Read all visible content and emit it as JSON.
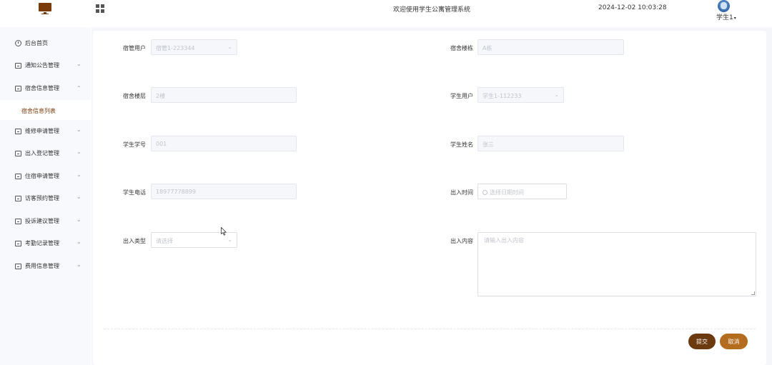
{
  "header": {
    "welcome": "欢迎使用学生公寓管理系统",
    "datetime": "2024-12-02 10:03:28",
    "username": "学生1",
    "caret": "▾"
  },
  "sidebar": {
    "items": [
      {
        "label": "后台首页",
        "icon": "clock-icon",
        "chevron": ""
      },
      {
        "label": "通知公告管理",
        "icon": "doc-icon",
        "chevron": "⌄"
      },
      {
        "label": "宿舍信息管理",
        "icon": "doc-icon",
        "chevron": "⌃"
      },
      {
        "label": "维修申请管理",
        "icon": "doc-icon",
        "chevron": "⌄"
      },
      {
        "label": "出入登记管理",
        "icon": "doc-icon",
        "chevron": "⌄"
      },
      {
        "label": "住宿申请管理",
        "icon": "doc-icon",
        "chevron": "⌄"
      },
      {
        "label": "访客预约管理",
        "icon": "doc-icon",
        "chevron": "⌄"
      },
      {
        "label": "投诉建议管理",
        "icon": "doc-icon",
        "chevron": "⌄"
      },
      {
        "label": "考勤记录管理",
        "icon": "doc-icon",
        "chevron": "⌄"
      },
      {
        "label": "费用信息管理",
        "icon": "doc-icon",
        "chevron": "⌄"
      }
    ],
    "active_sub": "宿舍信息列表"
  },
  "form": {
    "dorm_user": {
      "label": "宿管用户",
      "value": "宿管1-223344"
    },
    "dorm_building": {
      "label": "宿舍楼栋",
      "value": "A栋"
    },
    "dorm_floor": {
      "label": "宿舍楼层",
      "value": "2楼"
    },
    "student_user": {
      "label": "学生用户",
      "value": "学生1-112233"
    },
    "student_no": {
      "label": "学生学号",
      "value": "001"
    },
    "student_name": {
      "label": "学生姓名",
      "value": "张三"
    },
    "student_phone": {
      "label": "学生电话",
      "value": "18977778899"
    },
    "access_time": {
      "label": "出入时间",
      "placeholder": "选择日期时间"
    },
    "access_type": {
      "label": "出入类型",
      "placeholder": "请选择"
    },
    "access_content": {
      "label": "出入内容",
      "placeholder": "请输入出入内容"
    },
    "chevron": "⌄"
  },
  "actions": {
    "submit": "提交",
    "cancel": "取消"
  },
  "colors": {
    "brand": "#7a3b0a",
    "submit": "#6b3a0e",
    "cancel": "#b46d1e"
  }
}
